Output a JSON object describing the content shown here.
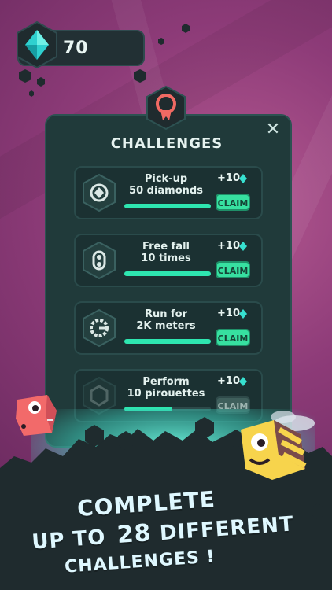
{
  "colors": {
    "accent": "#37e0a0",
    "panel": "#203a3a",
    "background": "#8d3b78",
    "ground": "#1f2b2e",
    "badge": "#f06a63"
  },
  "header": {
    "gem_count": "70",
    "gem_icon": "diamond-icon"
  },
  "panel": {
    "title": "CHALLENGES",
    "close_icon": "close-icon",
    "badge_icon": "medal-icon"
  },
  "challenges": [
    {
      "title_line1": "Pick-up",
      "title_line2": "50 diamonds",
      "reward": "+10",
      "claim": "CLAIM",
      "progress": 1.0,
      "icon": "pickup-icon"
    },
    {
      "title_line1": "Free fall",
      "title_line2": "10 times",
      "reward": "+10",
      "claim": "CLAIM",
      "progress": 1.0,
      "icon": "freefall-icon"
    },
    {
      "title_line1": "Run for",
      "title_line2": "2K meters",
      "reward": "+10",
      "claim": "CLAIM",
      "progress": 1.0,
      "icon": "run-icon"
    },
    {
      "title_line1": "Perform",
      "title_line2": "10 pirouettes",
      "reward": "+10",
      "claim": "CLAIM",
      "progress": 0.55,
      "icon": "pirouette-icon"
    }
  ],
  "promo": {
    "line1": "COMPLETE",
    "line2_prefix": "UP TO",
    "line2_number": "28",
    "line2_suffix": "DIFFERENT",
    "line3": "CHALLENGES !"
  }
}
